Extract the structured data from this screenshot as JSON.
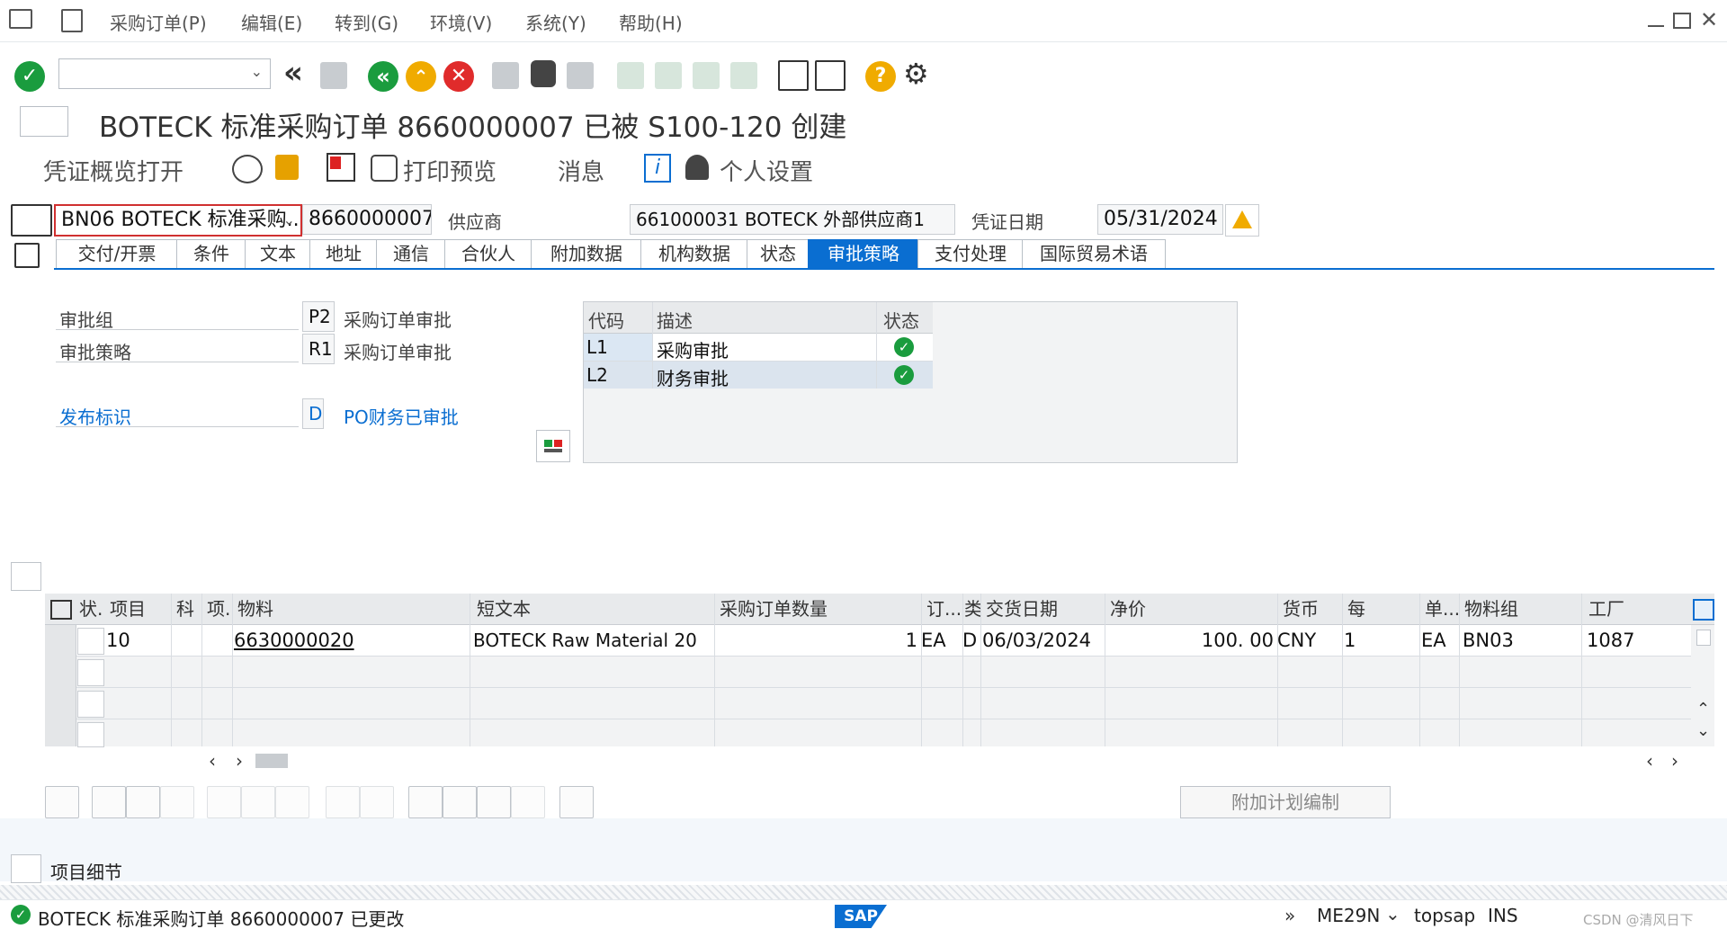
{
  "menu": {
    "items": [
      "采购订单(P)",
      "编辑(E)",
      "转到(G)",
      "环境(V)",
      "系统(Y)",
      "帮助(H)"
    ]
  },
  "toolbar": {
    "command_placeholder": ""
  },
  "title": "BOTECK 标准采购订单 8660000007 已被 S100-120 创建",
  "app_toolbar": {
    "doc_overview": "凭证概览打开",
    "print_preview": "打印预览",
    "messages": "消息",
    "personal_settings": "个人设置"
  },
  "header": {
    "doc_type": "BN06 BOTECK 标准采购..",
    "po_number": "8660000007",
    "vendor_label": "供应商",
    "vendor_value": "661000031 BOTECK 外部供应商1",
    "doc_date_label": "凭证日期",
    "doc_date_value": "05/31/2024"
  },
  "tabs": [
    "交付/开票",
    "条件",
    "文本",
    "地址",
    "通信",
    "合伙人",
    "附加数据",
    "机构数据",
    "状态",
    "审批策略",
    "支付处理",
    "国际贸易术语"
  ],
  "release": {
    "group_label": "审批组",
    "group_code": "P2",
    "group_desc": "采购订单审批",
    "strategy_label": "审批策略",
    "strategy_code": "R1",
    "strategy_desc": "采购订单审批",
    "indicator_label": "发布标识",
    "indicator_code": "D",
    "indicator_desc": "PO财务已审批"
  },
  "approval_table": {
    "headers": [
      "代码",
      "描述",
      "状态"
    ],
    "rows": [
      {
        "code": "L1",
        "desc": "采购审批"
      },
      {
        "code": "L2",
        "desc": "财务审批"
      }
    ]
  },
  "items_table": {
    "headers": [
      "状.",
      "项目",
      "科",
      "项.",
      "物料",
      "短文本",
      "采购订单数量",
      "订...",
      "类",
      "交货日期",
      "净价",
      "货币",
      "每",
      "单...",
      "物料组",
      "工厂"
    ],
    "row": {
      "item": "10",
      "material": "6630000020",
      "short_text": "BOTECK Raw Material 20",
      "qty": "1",
      "unit": "EA",
      "date_cat": "D",
      "delivery_date": "06/03/2024",
      "net_price": "100. 00",
      "currency": "CNY",
      "per": "1",
      "order_unit": "EA",
      "mat_group": "BN03",
      "plant": "1087"
    }
  },
  "add_planning_button": "附加计划编制",
  "item_detail_label": "项目细节",
  "status_bar": {
    "message": "BOTECK 标准采购订单 8660000007 已更改",
    "transaction": "ME29N",
    "system": "topsap",
    "mode": "INS",
    "watermark": "CSDN @清风日下"
  },
  "colors": {
    "accent": "#0a6ed1",
    "success": "#1a9c3e",
    "warning": "#f0ab00",
    "error": "#e02b2b"
  }
}
